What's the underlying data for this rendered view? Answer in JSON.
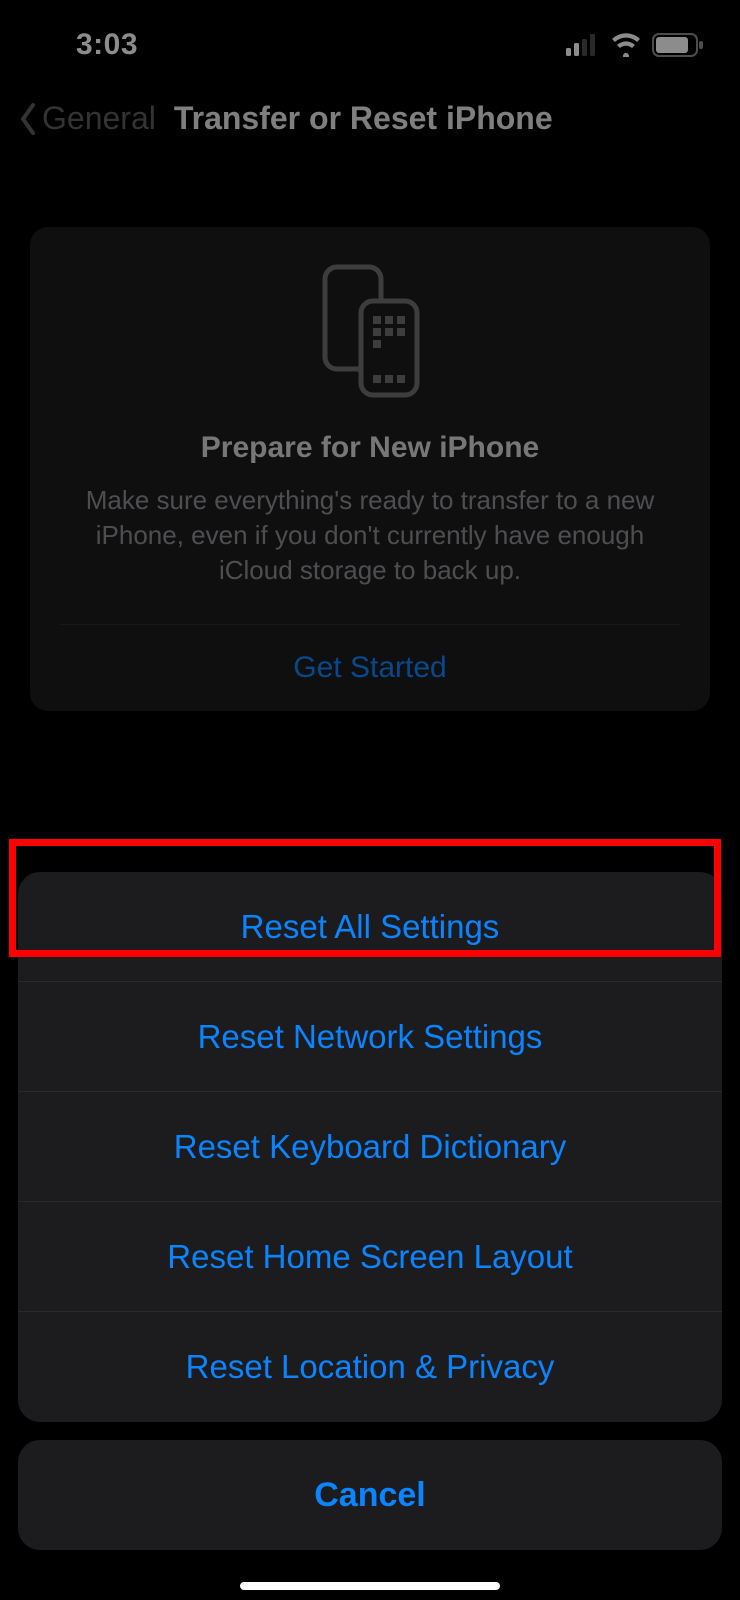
{
  "status": {
    "time": "3:03"
  },
  "nav": {
    "back_label": "General",
    "title": "Transfer or Reset iPhone"
  },
  "card": {
    "title": "Prepare for New iPhone",
    "description": "Make sure everything's ready to transfer to a new iPhone, even if you don't currently have enough iCloud storage to back up.",
    "cta": "Get Started"
  },
  "sheet": {
    "options": [
      "Reset All Settings",
      "Reset Network Settings",
      "Reset Keyboard Dictionary",
      "Reset Home Screen Layout",
      "Reset Location & Privacy"
    ],
    "cancel": "Cancel"
  }
}
